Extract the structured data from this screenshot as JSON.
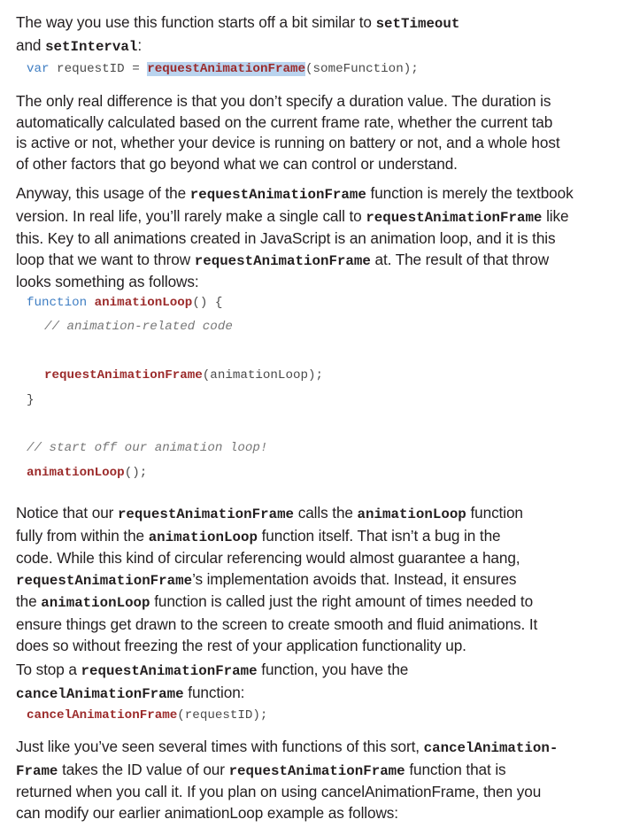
{
  "p1": {
    "l1_a": "The way you use this function starts off a bit similar to ",
    "l1_code": "setTimeout",
    "l2_a": "and ",
    "l2_code": "setInterval",
    "l2_b": ":"
  },
  "code1": {
    "kw": "var",
    "var": " requestID = ",
    "fn": "requestAnimationFrame",
    "rest": "(someFunction);"
  },
  "p2": {
    "lines": [
      "The only real difference is that you don’t specify a duration value. The duration is",
      "automatically calculated based on the current frame rate, whether the current tab",
      "is active or not, whether your device is running on battery or not, and a whole host",
      "of other factors that go beyond what we can control or understand."
    ]
  },
  "p3": {
    "l1_a": "Anyway, this usage of the ",
    "l1_code": "requestAnimationFrame",
    "l1_b": " function is merely the textbook",
    "l2_a": "version. In real life, you’ll rarely make a single call to ",
    "l2_code": "requestAnimationFrame",
    "l2_b": " like",
    "l3": "this. Key to all animations created in JavaScript is an animation loop, and it is this",
    "l4_a": "loop that we want to throw ",
    "l4_code": "requestAnimationFrame",
    "l4_b": " at. The result of that throw",
    "l5": "looks something as follows:"
  },
  "code2": {
    "kw": "function",
    "name": "animationLoop",
    "sig": "() {",
    "comment": "// animation-related code",
    "call_fn": "requestAnimationFrame",
    "call_rest": "(animationLoop);",
    "close": "}",
    "comment2": "// start off our animation loop!",
    "start_fn": "animationLoop",
    "start_rest": "();"
  },
  "p4": {
    "l1_a": "Notice that our ",
    "l1_code1": "requestAnimationFrame",
    "l1_b": " calls the ",
    "l1_code2": "animationLoop",
    "l1_c": " function",
    "l2_a": "fully from within the ",
    "l2_code": "animationLoop",
    "l2_b": " function itself. That isn’t a bug in the",
    "l3": "code. While this kind of circular referencing would almost guarantee a hang,",
    "l4_code": "requestAnimationFrame",
    "l4_b": "’s implementation avoids that. Instead, it ensures",
    "l5_a": "the ",
    "l5_code": "animationLoop",
    "l5_b": " function is called just the right amount of times needed to",
    "l6": "ensure things get drawn to the screen to create smooth and fluid animations. It",
    "l7": "does so without freezing the rest of your application functionality up."
  },
  "p5": {
    "l1_a": "To stop a ",
    "l1_code": "requestAnimationFrame",
    "l1_b": " function, you have the",
    "l2_code": "cancelAnimationFrame",
    "l2_b": " function:"
  },
  "code3": {
    "fn": "cancelAnimationFrame",
    "rest": "(requestID);"
  },
  "p6": {
    "l1_a": "Just like you’ve seen several times with functions of this sort, ",
    "l1_code": "cancelAnimation-",
    "l2_code1": "Frame",
    "l2_b": " takes the ID value of our ",
    "l2_code2": "requestAnimationFrame",
    "l2_c": " function that is",
    "l3": "returned when you call it. If you plan on using cancelAnimationFrame, then you",
    "l4": "can modify our earlier animationLoop example as follows:"
  }
}
